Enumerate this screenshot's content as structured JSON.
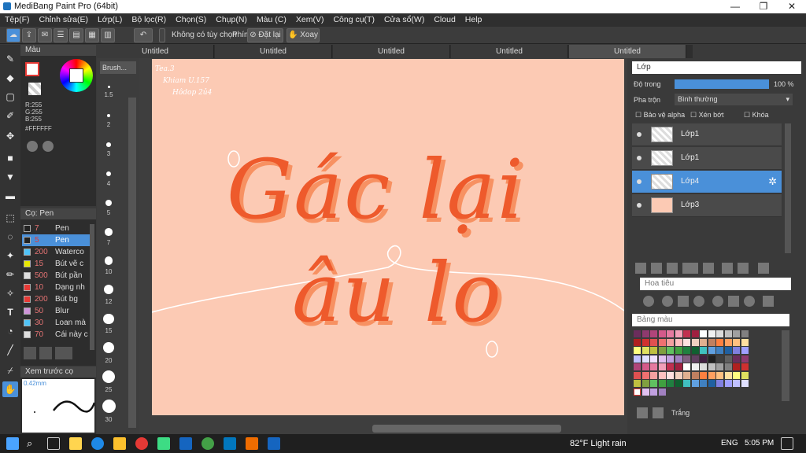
{
  "window": {
    "title": "MediBang Paint Pro (64bit)"
  },
  "menu": [
    "Tệp(F)",
    "Chỉnh sửa(E)",
    "Lớp(L)",
    "Bộ lọc(R)",
    "Chọn(S)",
    "Chụp(N)",
    "Màu (C)",
    "Xem(V)",
    "Công cụ(T)",
    "Cửa sổ(W)",
    "Cloud",
    "Help"
  ],
  "toolbar": {
    "option_label": "Không có tùy chọn",
    "key_label": "Phím",
    "reset_label": "Đặt lại",
    "rotate_label": "Xoay"
  },
  "tabs": [
    "Untitled",
    "Untitled",
    "Untitled",
    "Untitled",
    "Untitled"
  ],
  "color_panel": {
    "title": "Màu",
    "r": "R:255",
    "g": "G:255",
    "b": "B:255",
    "hex": "#FFFFFF"
  },
  "brush_panel": {
    "title": "Cọ: Pen",
    "items": [
      {
        "size": "7",
        "name": "Pen",
        "color": "#222222"
      },
      {
        "size": "5",
        "name": "Pen",
        "color": "#222222"
      },
      {
        "size": "200",
        "name": "Waterco",
        "color": "#4fc3f7"
      },
      {
        "size": "15",
        "name": "Bút vẽ c",
        "color": "#e8e800"
      },
      {
        "size": "500",
        "name": "Bút pần",
        "color": "#dddddd"
      },
      {
        "size": "10",
        "name": "Dạng nh",
        "color": "#e53935"
      },
      {
        "size": "200",
        "name": "Bút bg",
        "color": "#e53935"
      },
      {
        "size": "50",
        "name": "Blur",
        "color": "#ce93d8"
      },
      {
        "size": "30",
        "name": "Loan mà",
        "color": "#4fc3f7"
      },
      {
        "size": "70",
        "name": "Cái này c",
        "color": "#dddddd"
      }
    ]
  },
  "brush_label": "Brush...",
  "preview": {
    "title": "Xem trước cọ",
    "size": "0.42mm"
  },
  "size_list": [
    "1.5",
    "2",
    "3",
    "4",
    "5",
    "7",
    "10",
    "12",
    "15",
    "20",
    "25",
    "30"
  ],
  "canvas": {
    "note_lines": [
      "Tea.3",
      "Khiam U.157",
      "Hôdop 2ủ4"
    ],
    "main_line1": "Gác lại",
    "main_line2": "âu lo"
  },
  "layer_panel": {
    "title": "Lớp",
    "opacity_label": "Độ trong",
    "opacity_value": "100 %",
    "opacity": 1.0,
    "blend_label": "Pha trộn",
    "blend_value": "Bình thường",
    "protect_alpha": "Bảo vệ alpha",
    "clip": "Xén bớt",
    "lock": "Khóa",
    "layers": [
      {
        "name": "Lớp1",
        "selected": false
      },
      {
        "name": "Lớp1",
        "selected": false
      },
      {
        "name": "Lớp4",
        "selected": true
      },
      {
        "name": "Lớp3",
        "selected": false
      }
    ]
  },
  "navigator": {
    "title": "Hoa tiêu"
  },
  "palette": {
    "title": "Bảng màu",
    "footer": "Trắng"
  },
  "taskbar": {
    "weather": "82°F  Light rain",
    "lang": "ENG",
    "time": "5:05 PM"
  }
}
